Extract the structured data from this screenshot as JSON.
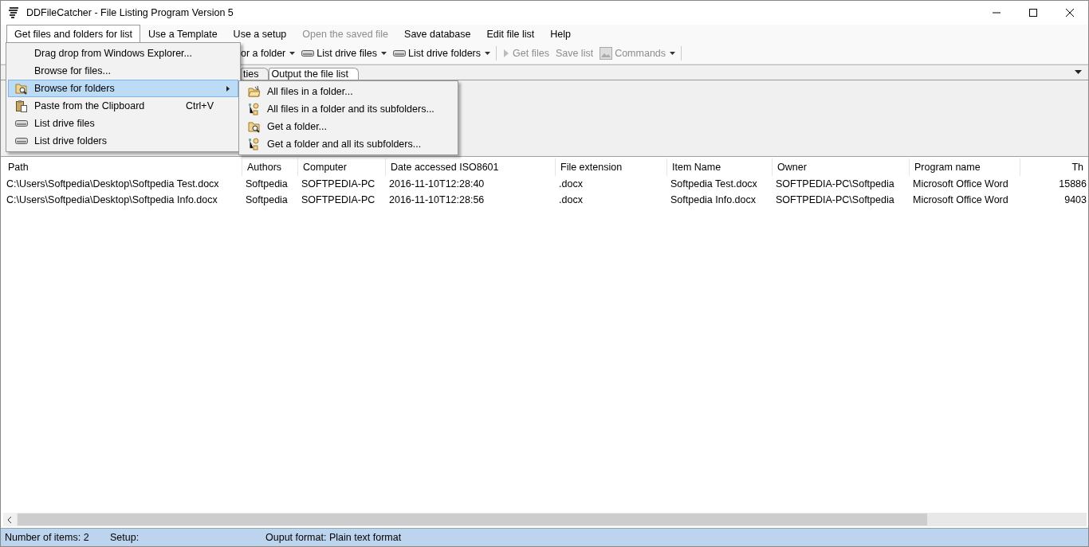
{
  "window": {
    "title": "DDFileCatcher - File Listing Program Version 5"
  },
  "menu_bar": [
    {
      "label": "Get files and folders for list",
      "selected": true,
      "disabled": false
    },
    {
      "label": "Use a Template",
      "selected": false,
      "disabled": false
    },
    {
      "label": "Use a setup",
      "selected": false,
      "disabled": false
    },
    {
      "label": "Open the saved file",
      "selected": false,
      "disabled": true
    },
    {
      "label": "Save database",
      "selected": false,
      "disabled": false
    },
    {
      "label": "Edit file list",
      "selected": false,
      "disabled": false
    },
    {
      "label": "Help",
      "selected": false,
      "disabled": false
    }
  ],
  "toolbar": [
    {
      "label": "or a folder",
      "kind": "plain",
      "dropdown": true,
      "disabled": false
    },
    {
      "label": "List drive files",
      "kind": "drive",
      "dropdown": true,
      "disabled": false
    },
    {
      "label": "List drive folders",
      "kind": "drive",
      "dropdown": true,
      "disabled": false
    },
    {
      "label": "Get files",
      "kind": "play",
      "dropdown": false,
      "disabled": true
    },
    {
      "label": "Save list",
      "kind": "plain",
      "dropdown": false,
      "disabled": true
    },
    {
      "label": "Commands",
      "kind": "image",
      "dropdown": true,
      "disabled": true
    }
  ],
  "tabs": [
    {
      "label": "ties",
      "selected": false
    },
    {
      "label": "Output the file list",
      "selected": true
    }
  ],
  "menu": {
    "items": [
      {
        "label": "Drag drop from Windows Explorer...",
        "kind": "plain",
        "selected": false,
        "has_submenu": false
      },
      {
        "label": "Browse for files...",
        "kind": "plain",
        "selected": false,
        "has_submenu": false
      },
      {
        "label": "Browse for folders",
        "kind": "folder-search",
        "selected": true,
        "has_submenu": true
      },
      {
        "label": "Paste from the Clipboard",
        "kind": "paste",
        "selected": false,
        "has_submenu": false,
        "shortcut": "Ctrl+V"
      },
      {
        "label": "List drive files",
        "kind": "drive",
        "selected": false,
        "has_submenu": false
      },
      {
        "label": "List drive folders",
        "kind": "drive",
        "selected": false,
        "has_submenu": false
      }
    ]
  },
  "submenu": {
    "items": [
      {
        "label": "All files in a folder...",
        "kind": "folder-open"
      },
      {
        "label": "All files in a folder and its subfolders...",
        "kind": "tree"
      },
      {
        "label": "Get a folder...",
        "kind": "folder-search"
      },
      {
        "label": "Get a folder and all its subfolders...",
        "kind": "tree"
      }
    ]
  },
  "table": {
    "columns": [
      "Path",
      "Authors",
      "Computer",
      "Date accessed ISO8601",
      "File extension",
      "Item Name",
      "Owner",
      "Program name",
      "Th"
    ],
    "rows": [
      [
        "C:\\Users\\Softpedia\\Desktop\\Softpedia Test.docx",
        "Softpedia",
        "SOFTPEDIA-PC",
        "2016-11-10T12:28:40",
        ".docx",
        "Softpedia Test.docx",
        "SOFTPEDIA-PC\\Softpedia",
        "Microsoft Office Word",
        "15886"
      ],
      [
        "C:\\Users\\Softpedia\\Desktop\\Softpedia Info.docx",
        "Softpedia",
        "SOFTPEDIA-PC",
        "2016-11-10T12:28:56",
        ".docx",
        "Softpedia Info.docx",
        "SOFTPEDIA-PC\\Softpedia",
        "Microsoft Office Word",
        "9403"
      ]
    ]
  },
  "status_bar": [
    "Number of items: 2",
    "Setup:",
    "Ouput format: Plain text format"
  ]
}
